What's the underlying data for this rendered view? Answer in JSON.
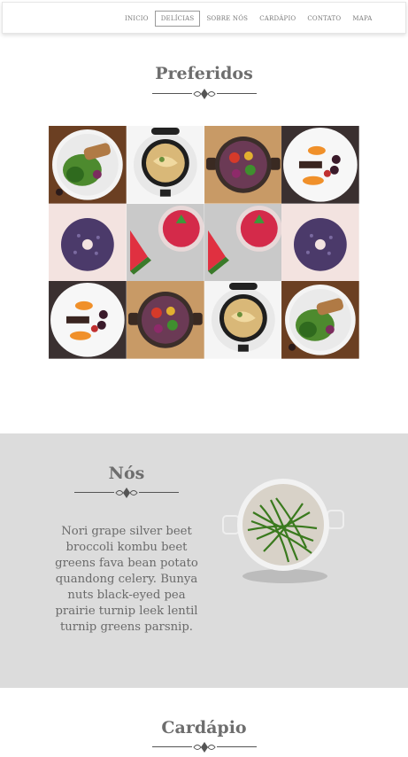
{
  "nav": {
    "items": [
      {
        "label": "INICIO"
      },
      {
        "label": "DELÍCIAS"
      },
      {
        "label": "SOBRE NÓS"
      },
      {
        "label": "CARDÁPIO"
      },
      {
        "label": "CONTATO"
      },
      {
        "label": "MAPA"
      }
    ]
  },
  "preferidos": {
    "title": "Preferidos",
    "gallery": [
      "salad-plate",
      "chicken-pan",
      "veggie-pan",
      "sweet-potato-plate",
      "blueberry-donut",
      "watermelon-juice",
      "watermelon-juice",
      "blueberry-donut",
      "sweet-potato-plate",
      "veggie-pan",
      "chicken-pan",
      "salad-plate"
    ]
  },
  "nos": {
    "title": "Nós",
    "body": "Nori grape silver beet broccoli kombu beet greens fava bean potato quandong celery. Bunya nuts black-eyed pea prairie turnip leek lentil turnip greens parsnip."
  },
  "cardapio": {
    "title": "Cardápio"
  }
}
